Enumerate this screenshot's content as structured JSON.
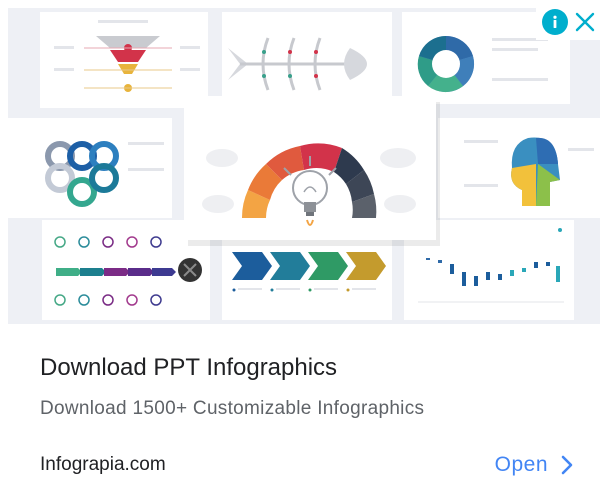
{
  "ad": {
    "title": "Download PPT Infographics",
    "description": "Download 1500+ Customizable Infographics",
    "domain": "Infograpia.com",
    "cta_label": "Open",
    "image_alt": "PPT infographic templates collage"
  },
  "controls": {
    "info_icon": "info-icon",
    "close_icon": "close-icon",
    "cta_icon": "chevron-right-icon"
  },
  "colors": {
    "accent": "#4285f4",
    "adchoices": "#00aecd",
    "title": "#202124",
    "description": "#5f6368"
  }
}
